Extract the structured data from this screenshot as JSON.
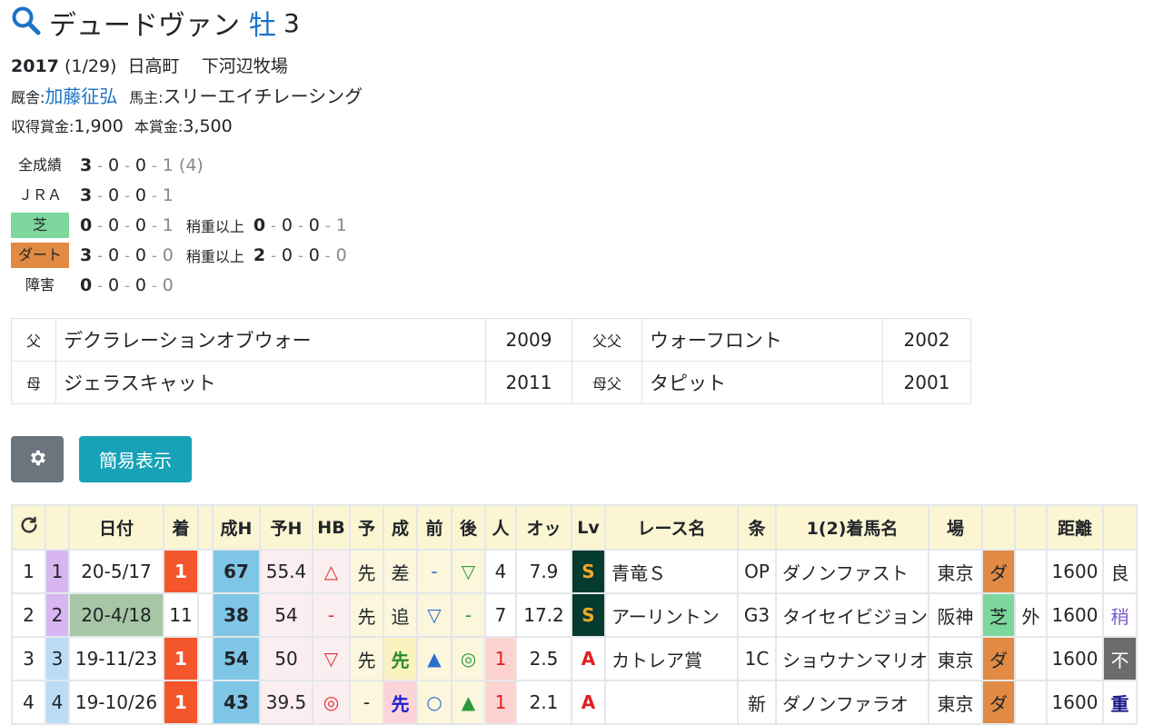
{
  "header": {
    "name": "デュードヴァン",
    "sex": "牡",
    "age": "3",
    "birth_year": "2017",
    "birth_date": "(1/29)",
    "birthplace": "日高町",
    "breeder": "下河辺牧場",
    "trainer_label": "厩舎:",
    "trainer": "加藤征弘",
    "owner_label": "馬主:",
    "owner": "スリーエイチレーシング",
    "earn_label": "収得賞金:",
    "earn": "1,900",
    "prize_label": "本賞金:",
    "prize": "3,500"
  },
  "records": {
    "all": {
      "label": "全成績",
      "v1": "3",
      "v2": "0",
      "v3": "0",
      "v4": "1",
      "extra": "(4)"
    },
    "jra": {
      "label": "ＪＲＡ",
      "v1": "3",
      "v2": "0",
      "v3": "0",
      "v4": "1"
    },
    "turf": {
      "label": "芝",
      "v1": "0",
      "v2": "0",
      "v3": "0",
      "v4": "1",
      "sub_label": "稍重以上",
      "s1": "0",
      "s2": "0",
      "s3": "0",
      "s4": "1"
    },
    "dirt": {
      "label": "ダート",
      "v1": "3",
      "v2": "0",
      "v3": "0",
      "v4": "0",
      "sub_label": "稍重以上",
      "s1": "2",
      "s2": "0",
      "s3": "0",
      "s4": "0"
    },
    "hurdle": {
      "label": "障害",
      "v1": "0",
      "v2": "0",
      "v3": "0",
      "v4": "0"
    }
  },
  "pedigree": {
    "sire_label": "父",
    "sire": "デクラレーションオブウォー",
    "sire_year": "2009",
    "sire_sire_label": "父父",
    "sire_sire": "ウォーフロント",
    "sire_sire_year": "2002",
    "dam_label": "母",
    "dam": "ジェラスキャット",
    "dam_year": "2011",
    "dam_sire_label": "母父",
    "dam_sire": "タピット",
    "dam_sire_year": "2001"
  },
  "buttons": {
    "settings_icon": "gear-icon",
    "simple_view": "簡易表示"
  },
  "table": {
    "headers": {
      "refresh_icon": "refresh-icon",
      "date": "日付",
      "finish": "着",
      "sei_h": "成H",
      "yo_h": "予H",
      "hb": "HB",
      "yo": "予",
      "sei": "成",
      "mae": "前",
      "ato": "後",
      "pop": "人",
      "odds": "オッ",
      "lv": "Lv",
      "race": "レース名",
      "cond": "条",
      "winner": "1(2)着馬名",
      "venue": "場",
      "dist": "距離"
    },
    "rows": [
      {
        "idx": "1",
        "n": "1",
        "date": "20-5/17",
        "finish": "1",
        "sei_h": "67",
        "yo_h": "55.4",
        "hb": "△",
        "yo": "先",
        "sei": "差",
        "mae": "-",
        "ato": "▽",
        "pop": "4",
        "odds": "7.9",
        "lv": "S",
        "race": "青竜Ｓ",
        "cond": "OP",
        "winner": "ダノンファスト",
        "venue": "東京",
        "surface": "ダ",
        "side": "",
        "dist": "1600",
        "going": "良"
      },
      {
        "idx": "2",
        "n": "2",
        "date": "20-4/18",
        "finish": "11",
        "sei_h": "38",
        "yo_h": "54",
        "hb": "-",
        "yo": "先",
        "sei": "追",
        "mae": "▽",
        "ato": "-",
        "pop": "7",
        "odds": "17.2",
        "lv": "S",
        "race": "アーリントン",
        "cond": "G3",
        "winner": "タイセイビジョン",
        "venue": "阪神",
        "surface": "芝",
        "side": "外",
        "dist": "1600",
        "going": "稍"
      },
      {
        "idx": "3",
        "n": "3",
        "date": "19-11/23",
        "finish": "1",
        "sei_h": "54",
        "yo_h": "50",
        "hb": "▽",
        "yo": "先",
        "sei": "先",
        "mae": "▲",
        "ato": "◎",
        "pop": "1",
        "odds": "2.5",
        "lv": "A",
        "race": "カトレア賞",
        "cond": "1C",
        "winner": "ショウナンマリオ",
        "venue": "東京",
        "surface": "ダ",
        "side": "",
        "dist": "1600",
        "going": "不"
      },
      {
        "idx": "4",
        "n": "4",
        "date": "19-10/26",
        "finish": "1",
        "sei_h": "43",
        "yo_h": "39.5",
        "hb": "◎",
        "yo": "-",
        "sei": "先",
        "mae": "○",
        "ato": "▲",
        "pop": "1",
        "odds": "2.1",
        "lv": "A",
        "race": "",
        "cond": "新",
        "winner": "ダノンファラオ",
        "venue": "東京",
        "surface": "ダ",
        "side": "",
        "dist": "1600",
        "going": "重"
      }
    ]
  },
  "colors": {
    "link": "#1a73c8",
    "turf": "#7dd69c",
    "dirt": "#e08a44",
    "win": "#f4562b",
    "settings_button": "#6c757d",
    "simple_button": "#17a2b8",
    "header_bg": "#fbf5d2"
  }
}
